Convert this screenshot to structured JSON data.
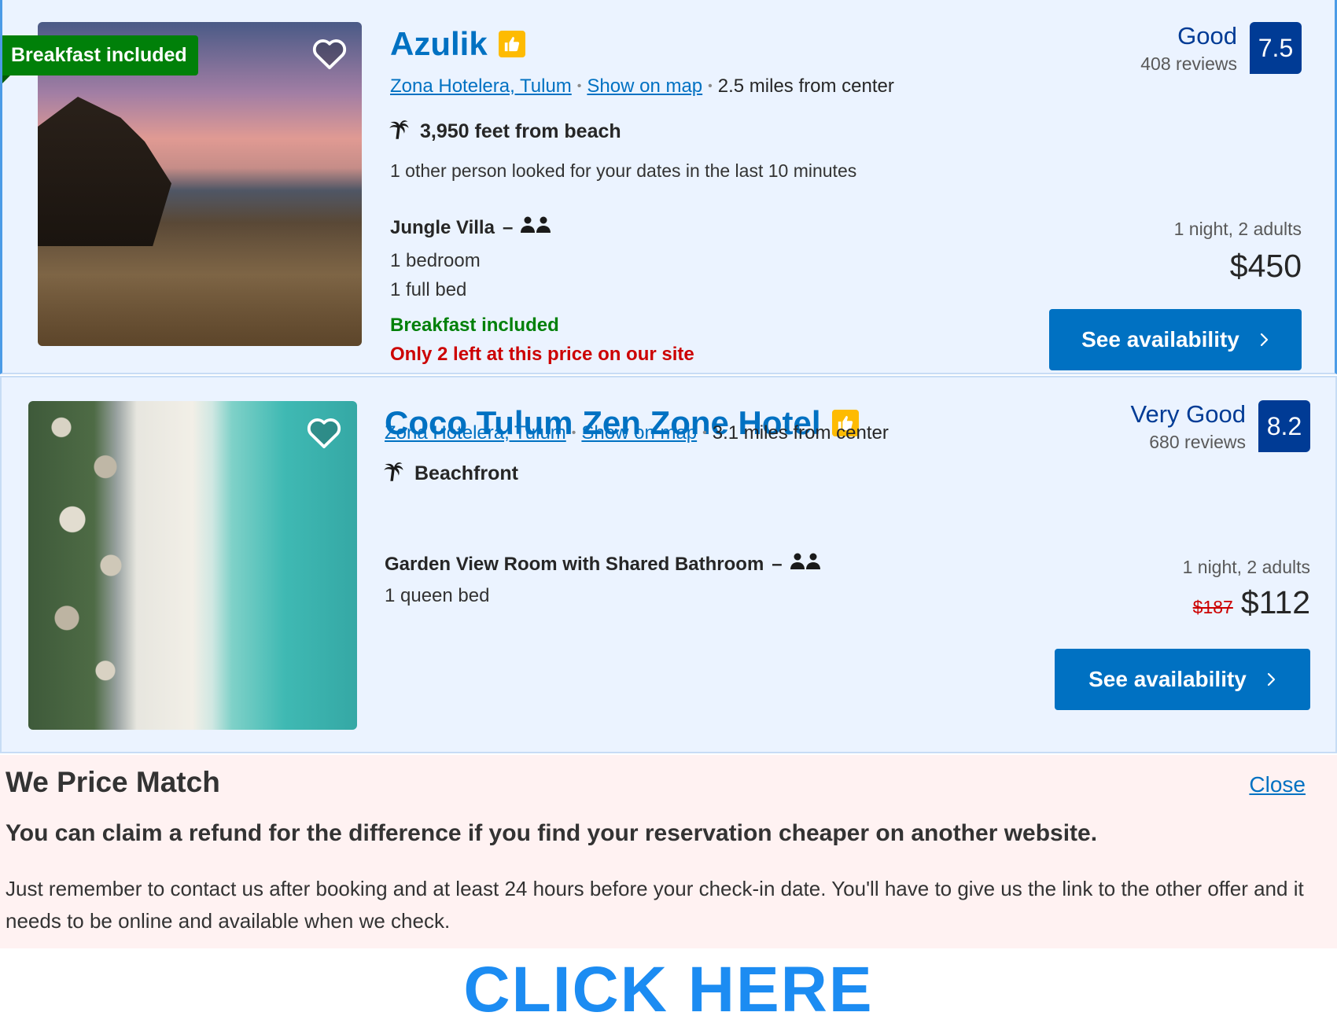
{
  "hotels": [
    {
      "ribbon": "Breakfast included",
      "name": "Azulik",
      "area": "Zona Hotelera, Tulum",
      "map_link": "Show on map",
      "distance": "2.5 miles from center",
      "beach": "3,950 feet from beach",
      "looked": "1 other person looked for your dates in the last 10 minutes",
      "room": "Jungle Villa",
      "room_dash": "–",
      "details": [
        "1 bedroom",
        "1 full bed"
      ],
      "perk": "Breakfast included",
      "scarcity": "Only 2 left at this price on our site",
      "rating_word": "Good",
      "reviews": "408 reviews",
      "score": "7.5",
      "stay": "1 night, 2 adults",
      "price": "$450",
      "cta": "See availability"
    },
    {
      "name": "Coco Tulum Zen Zone Hotel",
      "area": "Zona Hotelera, Tulum",
      "map_link": "Show on map",
      "distance": "3.1 miles from center",
      "beach": "Beachfront",
      "room": "Garden View Room with Shared Bathroom",
      "room_dash": "–",
      "details": [
        "1 queen bed"
      ],
      "rating_word": "Very Good",
      "reviews": "680 reviews",
      "score": "8.2",
      "stay": "1 night, 2 adults",
      "old_price": "$187",
      "price": "$112",
      "cta": "See availability"
    }
  ],
  "price_match": {
    "title": "We Price Match",
    "close": "Close",
    "headline": "You can claim a refund for the difference if you find your reservation cheaper on another website.",
    "body": "Just remember to contact us after booking and at least 24 hours before your check-in date. You'll have to give us the link to the other offer and it needs to be online and available when we check."
  },
  "banner": "CLICK HERE",
  "icons": {
    "favorite": "heart-icon",
    "preferred": "thumbs-up-icon",
    "beach": "palm-tree-icon",
    "occupancy": "two-persons-icon",
    "next": "chevron-right-icon"
  },
  "colors": {
    "brand_blue": "#0071c2",
    "score_navy": "#003b95",
    "green": "#008009",
    "red": "#cc0000",
    "preferred_yellow": "#febb02"
  }
}
